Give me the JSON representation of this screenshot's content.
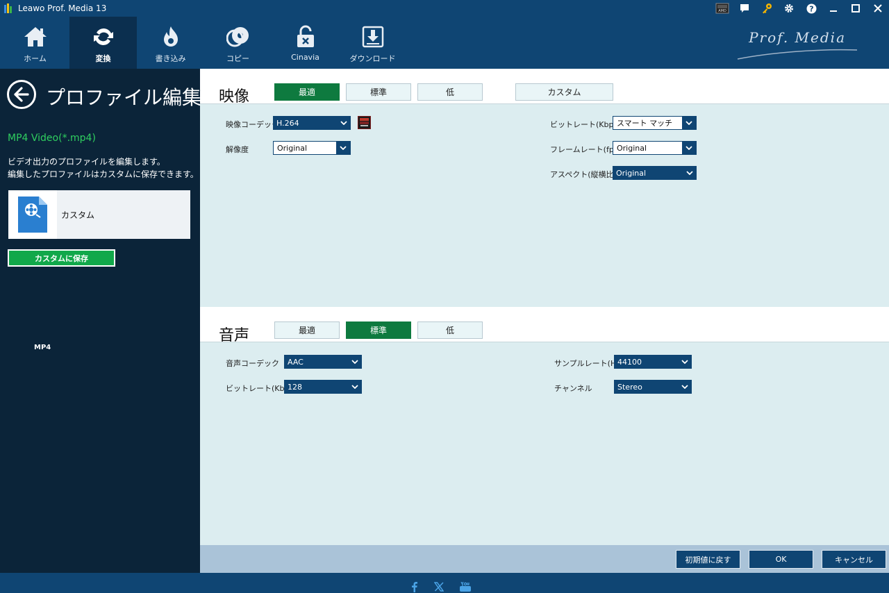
{
  "app": {
    "title": "Leawo Prof. Media 13"
  },
  "titlebar": {
    "icons": [
      "amd-icon",
      "feedback-icon",
      "key-icon",
      "gear-icon",
      "help-icon",
      "minimize-icon",
      "maximize-icon",
      "close-icon"
    ]
  },
  "nav": {
    "items": [
      {
        "label": "ホーム",
        "icon": "home-icon"
      },
      {
        "label": "変換",
        "icon": "convert-icon"
      },
      {
        "label": "書き込み",
        "icon": "burn-icon"
      },
      {
        "label": "コピー",
        "icon": "copy-icon"
      },
      {
        "label": "Cinavia",
        "icon": "cinavia-icon"
      },
      {
        "label": "ダウンロード",
        "icon": "download-icon"
      }
    ],
    "active": "変換",
    "brand": "Prof. Media"
  },
  "sidebar": {
    "title": "プロファイル編集",
    "format_name": "MP4 Video(*.mp4)",
    "desc_line1": "ビデオ出力のプロファイルを編集します。",
    "desc_line2": "編集したプロファイルはカスタムに保存できます。",
    "profile_label": "カスタム",
    "profile_badge": "MP4",
    "save_button": "カスタムに保存"
  },
  "video": {
    "title": "映像",
    "presets": [
      "最適",
      "標準",
      "低"
    ],
    "active_preset": "最適",
    "custom_button": "カスタム",
    "codec_label": "映像コーデック",
    "codec_value": "H.264",
    "resolution_label": "解像度",
    "resolution_value": "Original",
    "bitrate_label": "ビットレート(Kbps)",
    "bitrate_value": "スマート マッチ",
    "framerate_label": "フレームレート(fps)",
    "framerate_value": "Original",
    "aspect_label": "アスペクト(縦横比)",
    "aspect_value": "Original"
  },
  "audio": {
    "title": "音声",
    "presets": [
      "最適",
      "標準",
      "低"
    ],
    "active_preset": "標準",
    "codec_label": "音声コーデック",
    "codec_value": "AAC",
    "bitrate_label": "ビットレート(Kbps)",
    "bitrate_value": "128",
    "samplerate_label": "サンプルレート(Hz)",
    "samplerate_value": "44100",
    "channel_label": "チャンネル",
    "channel_value": "Stereo"
  },
  "footer": {
    "reset_button": "初期値に戻す",
    "ok_button": "OK",
    "cancel_button": "キャンセル"
  },
  "colors": {
    "header": "#0f4573",
    "sidebar": "#0b2439",
    "accent_green": "#0e7a3f",
    "panel": "#dcedf0"
  }
}
